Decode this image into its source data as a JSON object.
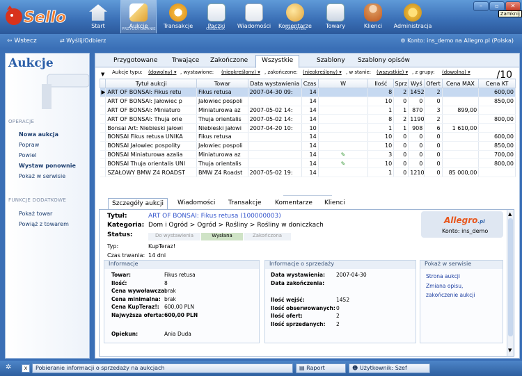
{
  "app": {
    "logo": "Sello",
    "window_tooltip": "Zamknij"
  },
  "nav": [
    {
      "label": "Start",
      "icon": "house-icon"
    },
    {
      "label": "Aukcje",
      "icon": "hammer-icon",
      "active": true
    },
    {
      "label": "Transakcje",
      "icon": "transactions-icon"
    },
    {
      "label": "Paczki",
      "icon": "package-icon"
    },
    {
      "label": "Wiadomości",
      "icon": "envelope-icon"
    },
    {
      "label": "Komentarze",
      "icon": "comments-icon"
    },
    {
      "label": "Towary",
      "icon": "goods-icon"
    },
    {
      "label": "Klienci",
      "icon": "clients-icon"
    },
    {
      "label": "Administracja",
      "icon": "admin-icon"
    }
  ],
  "nav_groups": [
    "PRZYGOTOWANIE",
    "OBSŁUGA",
    "KARTOTEKI"
  ],
  "toolbar": {
    "back": "Wstecz",
    "send": "Wyślij/Odbierz",
    "account": "Konto: ins_demo na Allegro.pl (Polska)"
  },
  "sidebar": {
    "title": "Aukcje",
    "sec_ops": "OPERACJE",
    "ops": [
      "Nowa aukcja",
      "Popraw",
      "Powiel",
      "Wystaw ponownie",
      "Pokaż w serwisie"
    ],
    "sec_extra": "FUNKCJE DODATKOWE",
    "extra": [
      "Pokaż towar",
      "Powiąż z towarem"
    ]
  },
  "tabs": [
    "Przygotowane",
    "Trwające",
    "Zakończone",
    "Wszystkie",
    "Szablony",
    "Szablony opisów"
  ],
  "filter": {
    "type_lbl": "Aukcje typu:",
    "type": "(dowolny)",
    "listed_lbl": ", wystawione:",
    "listed": "(nieokreślony)",
    "ended_lbl": ", zakończone:",
    "ended": "(nieokreślony)",
    "state_lbl": ", w stanie:",
    "state": "(wszystkie)",
    "group_lbl": ", z grupy:",
    "group": "(dowolna)",
    "count": "/10"
  },
  "grid": {
    "headers": [
      "",
      "Tytuł aukcji",
      "Towar",
      "Data wystawienia",
      "Czas",
      "W",
      "Ilość",
      "Sprz",
      "Wyś",
      "Ofert",
      "Cena MAX",
      "Cena KT"
    ],
    "rows": [
      [
        "▶",
        "ART OF BONSAI: Fikus retu",
        "Fikus retusa",
        "2007-04-30 09:",
        "14",
        "",
        "8",
        "2",
        "1452",
        "2",
        "",
        "600,00"
      ],
      [
        "",
        "ART OF BONSAI: Jałowiec p",
        "Jałowiec pospoli",
        "",
        "14",
        "",
        "10",
        "0",
        "0",
        "0",
        "",
        "850,00"
      ],
      [
        "",
        "ART OF BONSAI: Miniaturo",
        "Miniaturowa az",
        "2007-05-02 14:",
        "14",
        "",
        "1",
        "1",
        "870",
        "3",
        "899,00",
        ""
      ],
      [
        "",
        "ART OF BONSAI: Thuja orie",
        "Thuja orientalis",
        "2007-05-02 14:",
        "14",
        "",
        "8",
        "2",
        "1190",
        "2",
        "",
        "800,00"
      ],
      [
        "",
        "Bonsai Art: Niebieski jałowi",
        "Niebieski jałowi",
        "2007-04-20 10:",
        "10",
        "",
        "1",
        "1",
        "908",
        "6",
        "1 610,00",
        ""
      ],
      [
        "",
        "BONSAI Fikus retusa UNIKA",
        "Fikus retusa",
        "",
        "14",
        "",
        "10",
        "0",
        "0",
        "0",
        "",
        "600,00"
      ],
      [
        "",
        "BONSAI Jałowiec pospolity",
        "Jałowiec pospoli",
        "",
        "14",
        "",
        "10",
        "0",
        "0",
        "0",
        "",
        "850,00"
      ],
      [
        "",
        "BONSAI Miniaturowa azalia",
        "Miniaturowa az",
        "",
        "14",
        "✎",
        "3",
        "0",
        "0",
        "0",
        "",
        "700,00"
      ],
      [
        "",
        "BONSAI Thuja orientalis UNI",
        "Thuja orientalis",
        "",
        "14",
        "✎",
        "10",
        "0",
        "0",
        "0",
        "",
        "800,00"
      ],
      [
        "",
        "SZAŁOWY BMW Z4 ROADST",
        "BMW Z4 Roadst",
        "2007-05-02 19:",
        "14",
        "",
        "1",
        "0",
        "1210",
        "0",
        "85 000,00",
        ""
      ]
    ]
  },
  "detail_tabs": [
    "Szczegóły aukcji",
    "Wiadomości",
    "Transakcje",
    "Komentarze",
    "Klienci"
  ],
  "detail": {
    "title_lbl": "Tytuł:",
    "title": "ART OF BONSAI: Fikus retusa (100000003)",
    "cat_lbl": "Kategoria:",
    "category": "Dom i Ogród > Ogród > Rośliny > Rośliny w doniczkach",
    "status_lbl": "Status:",
    "status": [
      "Do wystawienia",
      "Wysłana",
      "Zakończona"
    ],
    "type_lbl": "Typ:",
    "type": "KupTeraz!",
    "dur_lbl": "Czas trwania:",
    "duration": "14 dni",
    "allegro": "Allegro",
    "allegro_pl": ".pl",
    "konto": "Konto: ins_demo",
    "info_h": "Informacje",
    "info": [
      [
        "Towar:",
        "Fikus retusa"
      ],
      [
        "Ilość:",
        "8"
      ],
      [
        "Cena wywoławcza:",
        "brak"
      ],
      [
        "Cena minimalna:",
        "brak"
      ],
      [
        "Cena KupTeraz!:",
        "600,00 PLN"
      ],
      [
        "Najwyższa oferta:",
        "600,00 PLN"
      ]
    ],
    "opiekun_lbl": "Opiekun:",
    "opiekun": "Ania Duda",
    "sale_h": "Informacje o sprzedaży",
    "sale_top": [
      [
        "Data wystawienia:",
        "2007-04-30"
      ],
      [
        "Data zakończenia:",
        ""
      ]
    ],
    "sale_bottom": [
      [
        "Ilość wejść:",
        "1452"
      ],
      [
        "Ilość obserwowanych:",
        "0"
      ],
      [
        "Ilość ofert:",
        "2"
      ],
      [
        "Ilość sprzedanych:",
        "2"
      ]
    ],
    "show_h": "Pokaż w serwisie",
    "links": [
      "Strona aukcji",
      "Zmiana opisu,",
      "zakończenie aukcji"
    ]
  },
  "status": {
    "message": "Pobieranie informacji o sprzedaży na aukcjach",
    "report": "Raport",
    "user": "Użytkownik: Szef"
  }
}
